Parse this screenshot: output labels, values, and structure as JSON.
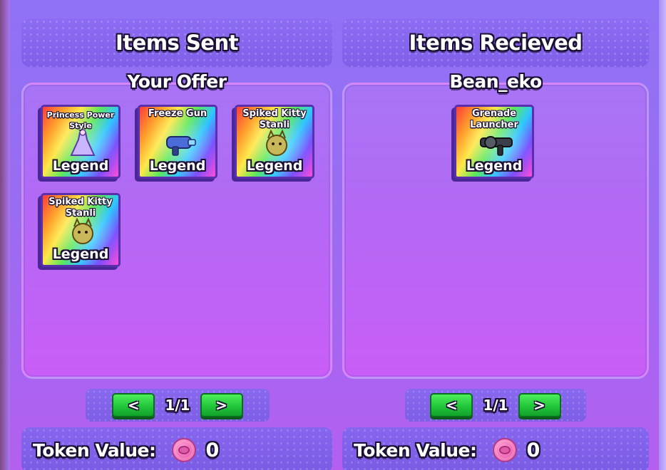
{
  "sent_panel": {
    "title": "Items Sent",
    "subtitle": "Your Offer",
    "items": [
      {
        "name": "Princess Power Style",
        "rarity": "Legend"
      },
      {
        "name": "Freeze Gun",
        "rarity": "Legend"
      },
      {
        "name": "Spiked Kitty Stanli",
        "rarity": "Legend"
      },
      {
        "name": "Spiked Kitty Stanli",
        "rarity": "Legend"
      }
    ],
    "pager": {
      "prev": "<",
      "label": "1/1",
      "next": ">"
    },
    "token": {
      "label": "Token Value:",
      "value": "0"
    }
  },
  "received_panel": {
    "title": "Items Recieved",
    "subtitle": "Bean_eko",
    "items": [
      {
        "name": "Grenade Launcher",
        "rarity": "Legend"
      }
    ],
    "pager": {
      "prev": "<",
      "label": "1/1",
      "next": ">"
    },
    "token": {
      "label": "Token Value:",
      "value": "0"
    }
  },
  "colors": {
    "background": "#9a6cf2",
    "panel": "#b468f5",
    "button_green": "#22c63a",
    "token_coin": "#f06bb6",
    "text_outline": "#1b1034"
  },
  "icons": {
    "prev": "chevron-left-icon",
    "next": "chevron-right-icon",
    "token": "token-coin-icon"
  }
}
